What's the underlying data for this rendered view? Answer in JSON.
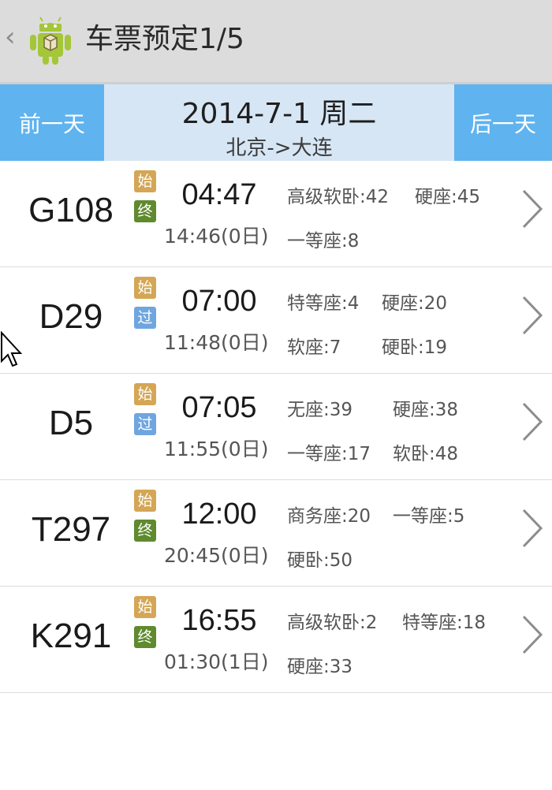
{
  "action_bar": {
    "back_glyph": "‹",
    "title": "车票预定1/5",
    "app_icon": "android-icon"
  },
  "date_nav": {
    "prev_label": "前一天",
    "next_label": "后一天",
    "date": "2014-7-1 周二",
    "route": "北京->大连"
  },
  "badge_colors": {
    "start": "#d4a655",
    "end": "#5f8a2e",
    "pass": "#6fa6e0"
  },
  "trains": [
    {
      "number": "G108",
      "badge_top": "始",
      "badge_bottom": "终",
      "badge_bottom_type": "end",
      "departure": "04:47",
      "arrival": "14:46(0日)",
      "seats": [
        "高级软卧:42",
        "硬座:45",
        "一等座:8",
        ""
      ]
    },
    {
      "number": "D29",
      "badge_top": "始",
      "badge_bottom": "过",
      "badge_bottom_type": "pass",
      "departure": "07:00",
      "arrival": "11:48(0日)",
      "seats": [
        "特等座:4",
        "硬座:20",
        "软座:7",
        "硬卧:19"
      ]
    },
    {
      "number": "D5",
      "badge_top": "始",
      "badge_bottom": "过",
      "badge_bottom_type": "pass",
      "departure": "07:05",
      "arrival": "11:55(0日)",
      "seats": [
        "无座:39",
        "硬座:38",
        "一等座:17",
        "软卧:48"
      ]
    },
    {
      "number": "T297",
      "badge_top": "始",
      "badge_bottom": "终",
      "badge_bottom_type": "end",
      "departure": "12:00",
      "arrival": "20:45(0日)",
      "seats": [
        "商务座:20",
        "一等座:5",
        "硬卧:50",
        ""
      ]
    },
    {
      "number": "K291",
      "badge_top": "始",
      "badge_bottom": "终",
      "badge_bottom_type": "end",
      "departure": "16:55",
      "arrival": "01:30(1日)",
      "seats": [
        "高级软卧:2",
        "特等座:18",
        "硬座:33",
        ""
      ]
    }
  ]
}
